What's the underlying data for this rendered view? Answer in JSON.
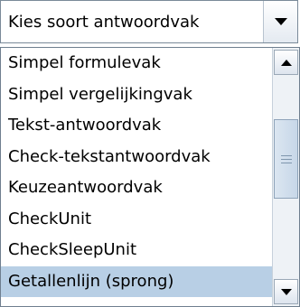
{
  "combo": {
    "selected_text": "Kies soort antwoordvak",
    "arrow_icon": "chevron-down-icon"
  },
  "list": {
    "items": [
      "Simpel formulevak",
      "Simpel vergelijkingvak",
      "Tekst-antwoordvak",
      "Check-tekstantwoordvak",
      "Keuzeantwoordvak",
      "CheckUnit",
      "CheckSleepUnit",
      "Getallenlijn (sprong)"
    ],
    "selected_index": 7
  },
  "scrollbar": {
    "up_icon": "arrow-up-icon",
    "down_icon": "arrow-down-icon",
    "thumb_position_fraction": 0.35,
    "thumb_size_fraction": 0.4
  },
  "colors": {
    "selection": "#b8cfe5",
    "border": "#7a8a99"
  }
}
